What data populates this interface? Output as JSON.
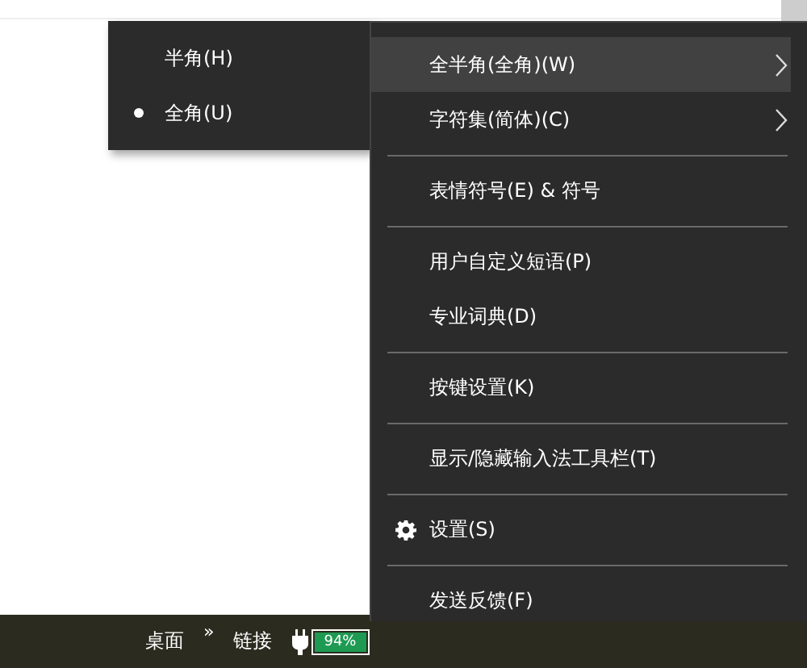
{
  "submenu": {
    "items": [
      {
        "label": "半角(H)",
        "selected": false
      },
      {
        "label": "全角(U)",
        "selected": true
      }
    ]
  },
  "menu": {
    "items": [
      {
        "kind": "item",
        "label": "全半角(全角)(W)",
        "highlighted": true,
        "submenu": true
      },
      {
        "kind": "item",
        "label": "字符集(简体)(C)",
        "highlighted": false,
        "submenu": true
      },
      {
        "kind": "separator"
      },
      {
        "kind": "item",
        "label": "表情符号(E) & 符号",
        "highlighted": false,
        "submenu": false
      },
      {
        "kind": "separator"
      },
      {
        "kind": "item",
        "label": "用户自定义短语(P)",
        "highlighted": false,
        "submenu": false
      },
      {
        "kind": "item",
        "label": "专业词典(D)",
        "highlighted": false,
        "submenu": false
      },
      {
        "kind": "separator"
      },
      {
        "kind": "item",
        "label": "按键设置(K)",
        "highlighted": false,
        "submenu": false
      },
      {
        "kind": "separator"
      },
      {
        "kind": "item",
        "label": "显示/隐藏输入法工具栏(T)",
        "highlighted": false,
        "submenu": false
      },
      {
        "kind": "separator"
      },
      {
        "kind": "gear_item",
        "label": "设置(S)",
        "highlighted": false,
        "submenu": false
      },
      {
        "kind": "separator"
      },
      {
        "kind": "item",
        "label": "发送反馈(F)",
        "highlighted": false,
        "submenu": false
      }
    ]
  },
  "taskbar": {
    "toolbars": [
      "桌面",
      "链接"
    ],
    "overflow": "»",
    "battery": {
      "reading": "94%",
      "level": 0.94
    }
  }
}
